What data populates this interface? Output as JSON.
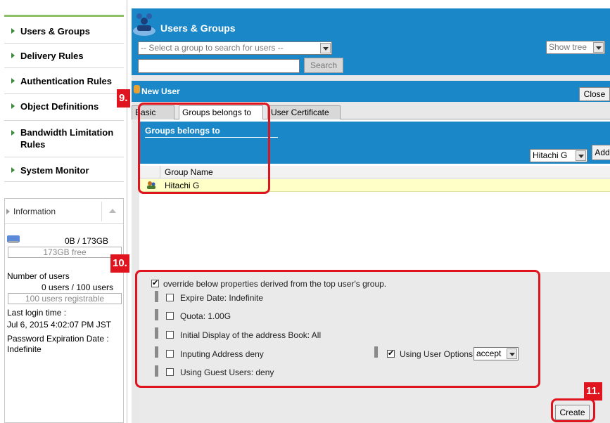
{
  "sidebar": {
    "nav": [
      {
        "label": "Users & Groups"
      },
      {
        "label": "Delivery Rules"
      },
      {
        "label": "Authentication Rules"
      },
      {
        "label": "Object Definitions"
      },
      {
        "label": "Bandwidth Limitation Rules"
      },
      {
        "label": "System Monitor"
      }
    ],
    "info": {
      "title": "Information",
      "disk_usage": "0B / 173GB",
      "disk_free": "173GB free",
      "users_label": "Number of users",
      "users_value": "0 users / 100 users",
      "users_registrable": "100 users registrable",
      "last_login_label": "Last login time :",
      "last_login_value": "Jul 6, 2015 4:02:07 PM JST",
      "password_exp_label": "Password Expiration Date :",
      "password_exp_value": "Indefinite"
    }
  },
  "users_groups": {
    "title": "Users & Groups",
    "group_select_placeholder": "-- Select a group to search for users --",
    "search_label": "Search",
    "show_tree_label": "Show tree"
  },
  "new_user": {
    "title": "New User",
    "close_label": "Close",
    "tabs": [
      {
        "label": "Basic"
      },
      {
        "label": "Groups belongs to"
      },
      {
        "label": "User Certificate"
      }
    ],
    "groups_header": "Groups belongs to",
    "group_select_value": "Hitachi G",
    "add_label": "Add",
    "column_group_name": "Group Name",
    "groups": [
      {
        "name": "Hitachi G"
      }
    ]
  },
  "properties": {
    "override_label": "override below properties derived from the top user's group.",
    "override_checked": true,
    "expire_date": "Expire Date: Indefinite",
    "quota": "Quota: 1.00G",
    "initial_display": "Initial Display of the address Book: All",
    "inputing_address": "Inputing Address deny",
    "using_guest_users": "Using Guest Users: deny",
    "using_user_options": "Using User Options:",
    "user_options_value": "accept",
    "using_user_options_checked": true
  },
  "create_label": "Create",
  "annotations": {
    "step9": "9.",
    "step10": "10.",
    "step11": "11.",
    "color": "#e0141e"
  },
  "colors": {
    "header_blue": "#1a87c8",
    "sidebar_green_line": "#8ec06a",
    "group_row_yellow": "#ffffc8"
  }
}
